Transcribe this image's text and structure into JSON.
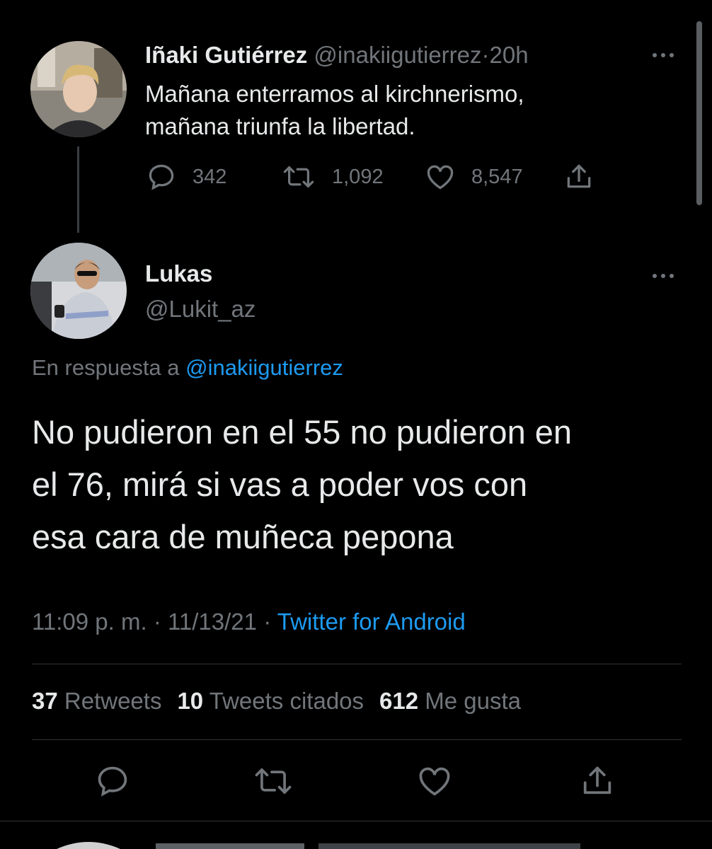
{
  "parent_tweet": {
    "name": "Iñaki Gutiérrez",
    "handle": "@inakiigutierrez",
    "separator": "·",
    "time": "20h",
    "text_line1": "Mañana enterramos al kirchnerismo,",
    "text_line2": "mañana triunfa la libertad.",
    "replies": "342",
    "retweets": "1,092",
    "likes": "8,547"
  },
  "reply_tweet": {
    "name": "Lukas",
    "handle": "@Lukit_az",
    "in_reply_prefix": "En respuesta a",
    "in_reply_handle": "@inakiigutierrez",
    "text_line1": "No pudieron en el 55 no pudieron en",
    "text_line2": "el 76, mirá si vas a poder vos con",
    "text_line3": "esa cara de muñeca pepona",
    "time": "11:09 p. m.",
    "dot1": "·",
    "date": "11/13/21",
    "dot2": "·",
    "source": "Twitter for Android",
    "retweets_count": "37",
    "retweets_label": "Retweets",
    "quotes_count": "10",
    "quotes_label": "Tweets citados",
    "likes_count": "612",
    "likes_label": "Me gusta"
  },
  "icons": {
    "reply": "reply-icon",
    "retweet": "retweet-icon",
    "like": "heart-icon",
    "share": "share-icon",
    "more": "more-icon"
  },
  "colors": {
    "background": "#000000",
    "text": "#e7e9ea",
    "muted": "#71767b",
    "link": "#1d9bf0",
    "divider": "#2f3336"
  }
}
